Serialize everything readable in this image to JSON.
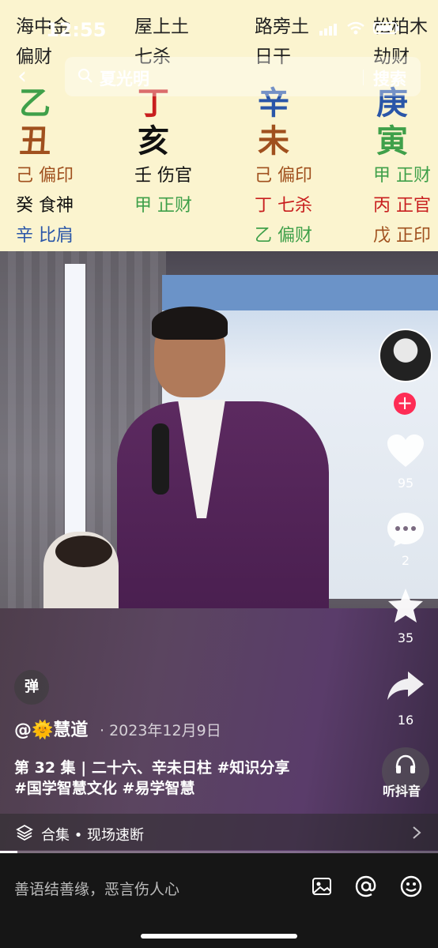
{
  "status_bar": {
    "time": "12:55",
    "battery_level": 0.85
  },
  "bazi_chart": {
    "nayin": [
      "海中金",
      "屋上土",
      "路旁土",
      "松柏木"
    ],
    "ten_gods": [
      "偏财",
      "七杀",
      "日干",
      "劫财"
    ],
    "stems": [
      {
        "char": "乙",
        "color": "#3fa04a"
      },
      {
        "char": "丁",
        "color": "#c81e1e"
      },
      {
        "char": "辛",
        "color": "#2a56a8"
      },
      {
        "char": "庚",
        "color": "#2a56a8"
      }
    ],
    "branches": [
      {
        "char": "丑",
        "color": "#a0501e"
      },
      {
        "char": "亥",
        "color": "#111111"
      },
      {
        "char": "未",
        "color": "#a0501e"
      },
      {
        "char": "寅",
        "color": "#3fa04a"
      }
    ],
    "hidden_stems": [
      [
        {
          "text": "己 偏印",
          "color": "#a0501e"
        },
        {
          "text": "癸 食神",
          "color": "#111111"
        },
        {
          "text": "辛 比肩",
          "color": "#2a56a8"
        }
      ],
      [
        {
          "text": "壬 伤官",
          "color": "#111111"
        },
        {
          "text": "甲 正财",
          "color": "#3fa04a"
        }
      ],
      [
        {
          "text": "己 偏印",
          "color": "#a0501e"
        },
        {
          "text": "丁 七杀",
          "color": "#c81e1e"
        },
        {
          "text": "乙 偏财",
          "color": "#3fa04a"
        }
      ],
      [
        {
          "text": "甲 正财",
          "color": "#3fa04a"
        },
        {
          "text": "丙 正官",
          "color": "#c81e1e"
        },
        {
          "text": "戊 正印",
          "color": "#a0501e"
        }
      ]
    ]
  },
  "search": {
    "query": "夏光明",
    "button": "搜索"
  },
  "actions": {
    "like_count": "95",
    "comment_count": "2",
    "favorite_count": "35",
    "share_count": "16",
    "follow": "+",
    "listen_label": "听抖音"
  },
  "danmaku": "弹",
  "post": {
    "author": "@🌞慧道",
    "date": "· 2023年12月9日",
    "caption_line1": "第 32 集 | 二十六、辛未日柱 #知识分享",
    "caption_line2": "#国学智慧文化  #易学智慧"
  },
  "collection": {
    "label": "合集 • 现场速断"
  },
  "progress": 0.04,
  "comment_placeholder": "善语结善缘，恶言伤人心",
  "colors": {
    "like": "#ffffff",
    "follow": "#fe2c55",
    "chart_bg": "#fbf4cf"
  }
}
